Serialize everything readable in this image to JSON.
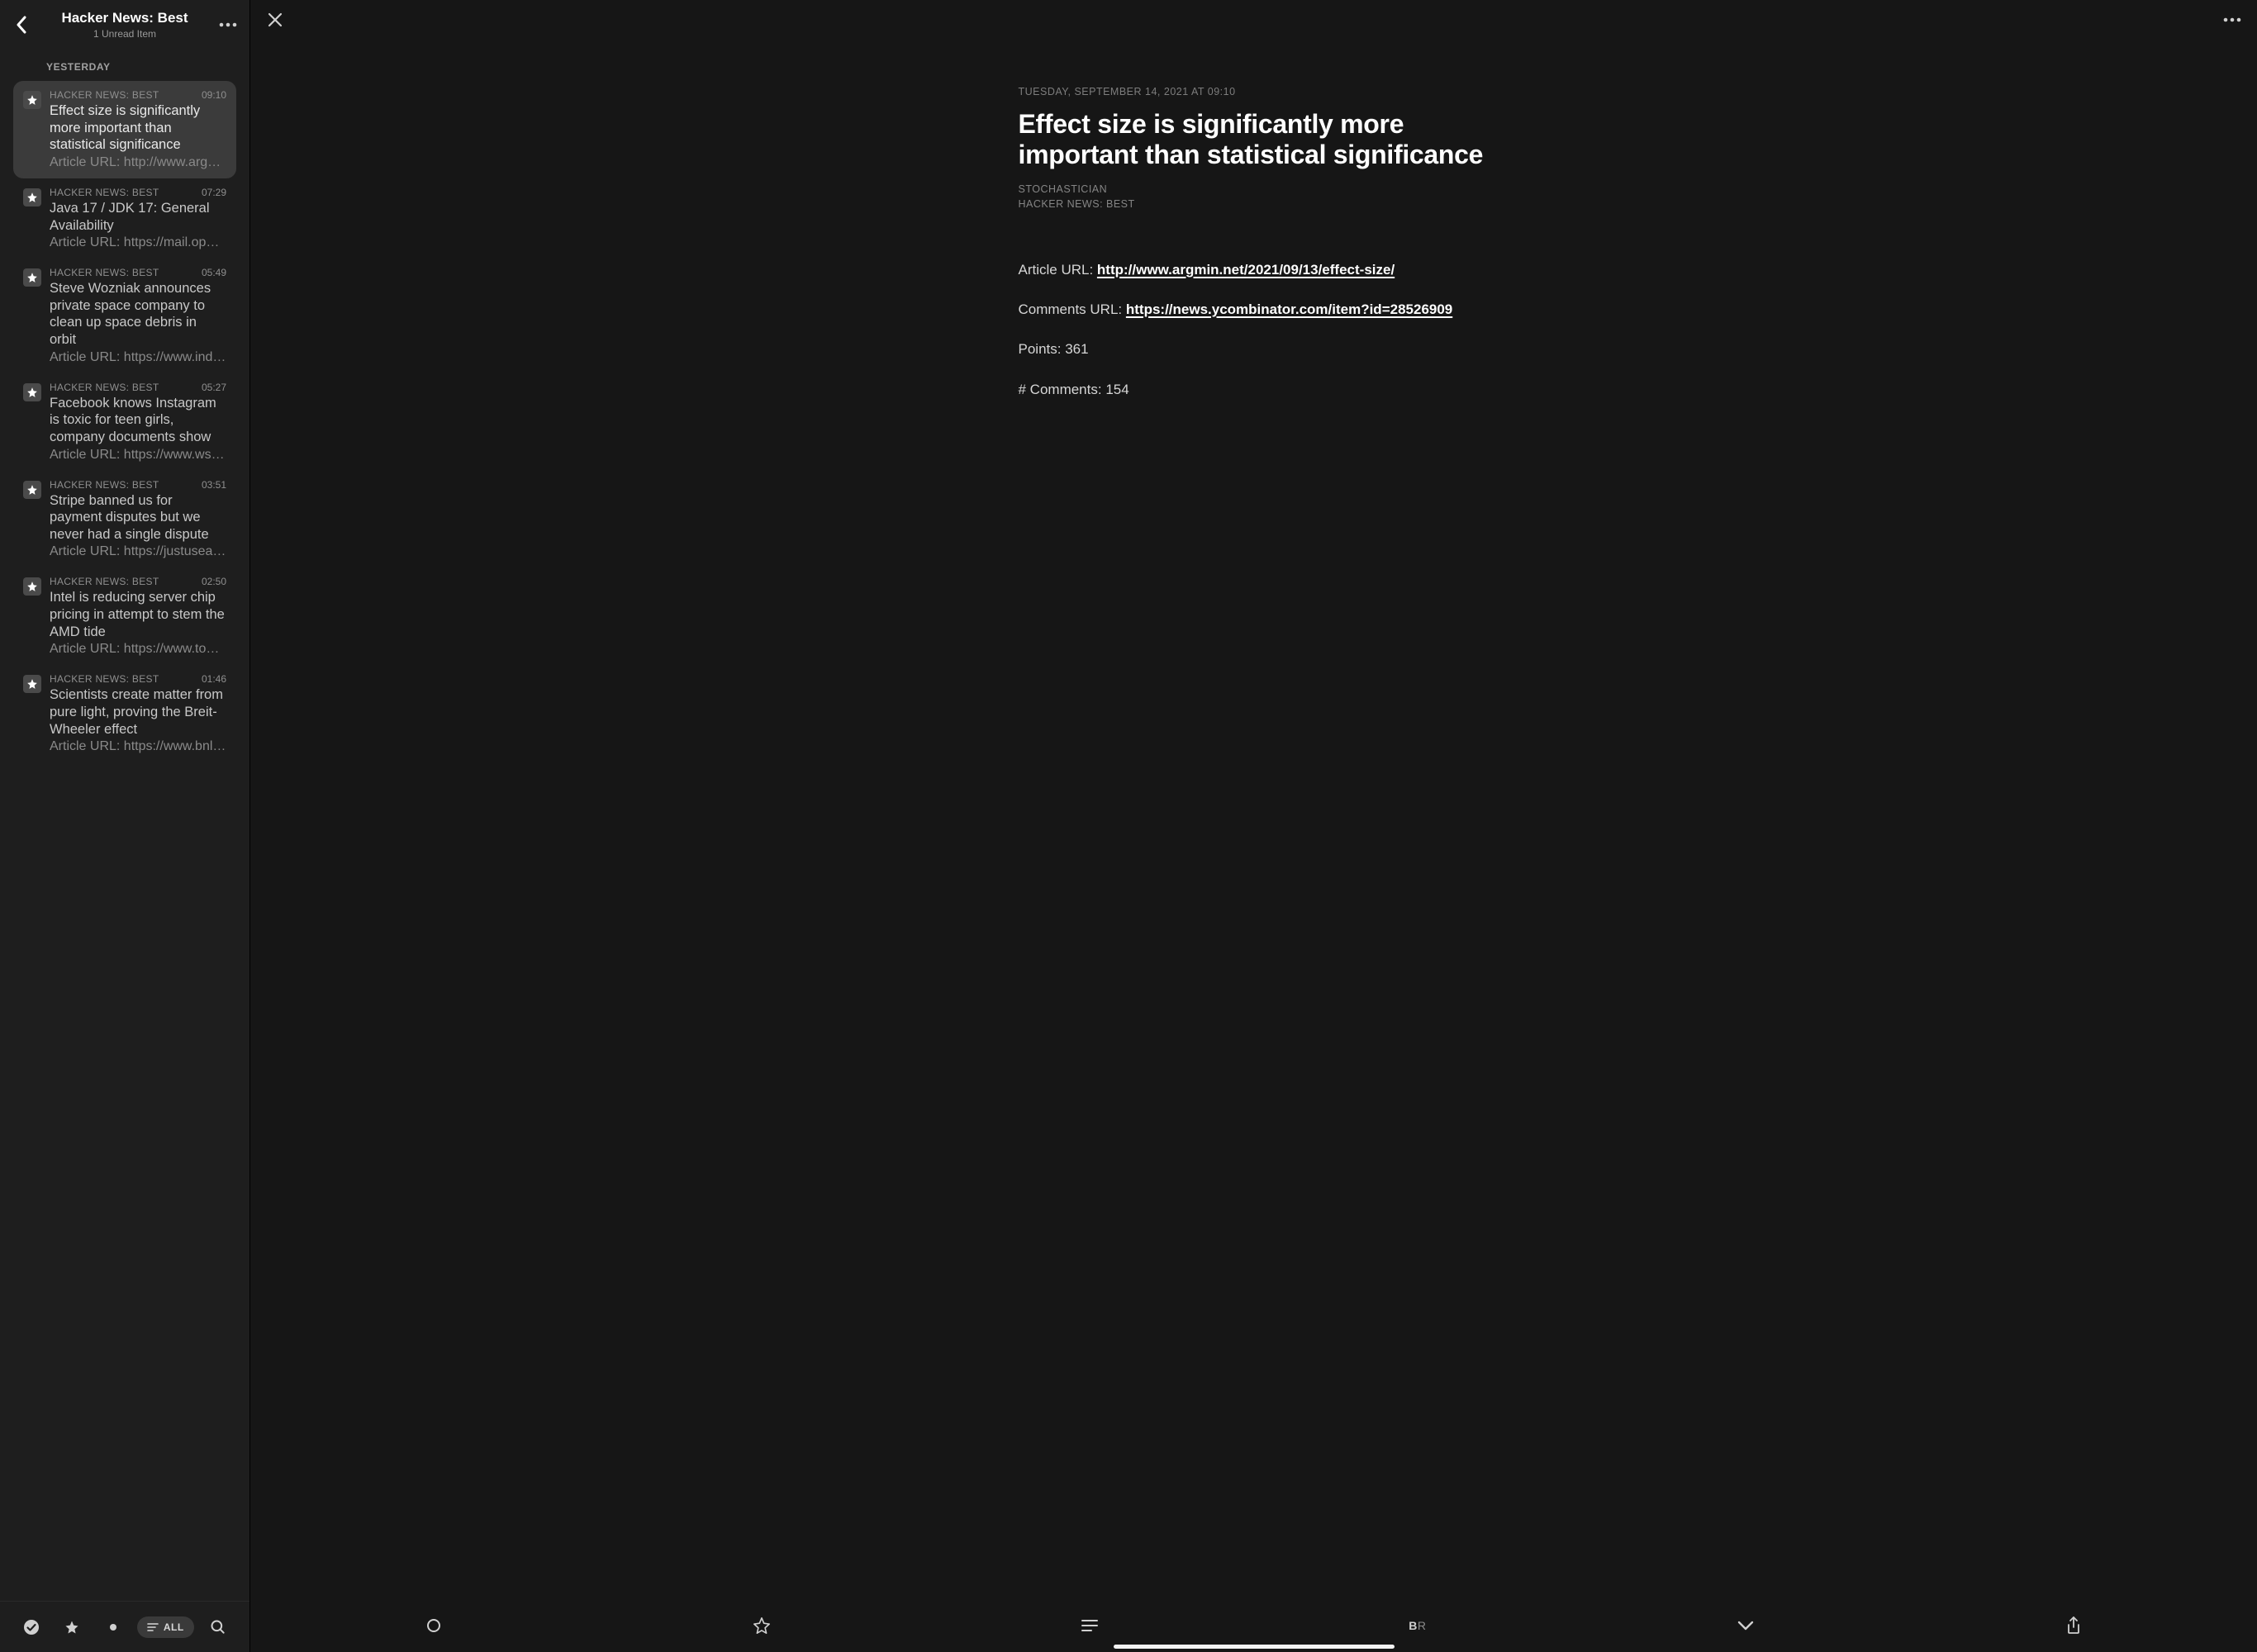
{
  "sidebar": {
    "title": "Hacker News: Best",
    "subtitle": "1 Unread Item",
    "section_label": "YESTERDAY",
    "filter_label": "ALL",
    "items": [
      {
        "feed": "HACKER NEWS: BEST",
        "time": "09:10",
        "title": "Effect size is significantly more important than statistical significance",
        "snippet": "Article URL: http://www.argm…",
        "selected": true
      },
      {
        "feed": "HACKER NEWS: BEST",
        "time": "07:29",
        "title": "Java 17 / JDK 17: General Availability",
        "snippet": "Article URL: https://mail.open…",
        "selected": false
      },
      {
        "feed": "HACKER NEWS: BEST",
        "time": "05:49",
        "title": "Steve Wozniak announces private space company to clean up space debris in orbit",
        "snippet": "Article URL: https://www.inde…",
        "selected": false
      },
      {
        "feed": "HACKER NEWS: BEST",
        "time": "05:27",
        "title": "Facebook knows Instagram is toxic for teen girls, company documents show",
        "snippet": "Article URL: https://www.wsj.…",
        "selected": false
      },
      {
        "feed": "HACKER NEWS: BEST",
        "time": "03:51",
        "title": "Stripe banned us for payment disputes but we never had a single dispute",
        "snippet": "Article URL: https://justuseap…",
        "selected": false
      },
      {
        "feed": "HACKER NEWS: BEST",
        "time": "02:50",
        "title": "Intel is reducing server chip pricing in attempt to stem the AMD tide",
        "snippet": "Article URL: https://www.tom…",
        "selected": false
      },
      {
        "feed": "HACKER NEWS: BEST",
        "time": "01:46",
        "title": "Scientists create matter from pure light, proving the Breit-Wheeler effect",
        "snippet": "Article URL: https://www.bnl.…",
        "selected": false
      }
    ]
  },
  "article": {
    "datestamp": "TUESDAY, SEPTEMBER 14, 2021 AT 09:10",
    "headline": "Effect size is significantly more important than statistical significance",
    "author": "STOCHASTICIAN",
    "feed": "HACKER NEWS: BEST",
    "article_url_label": "Article URL: ",
    "article_url": "http://www.argmin.net/2021/09/13/effect-size/",
    "comments_url_label": "Comments URL: ",
    "comments_url": "https://news.ycombinator.com/item?id=28526909",
    "points_label": "Points: ",
    "points": "361",
    "comments_label": "# Comments: ",
    "comments": "154"
  }
}
